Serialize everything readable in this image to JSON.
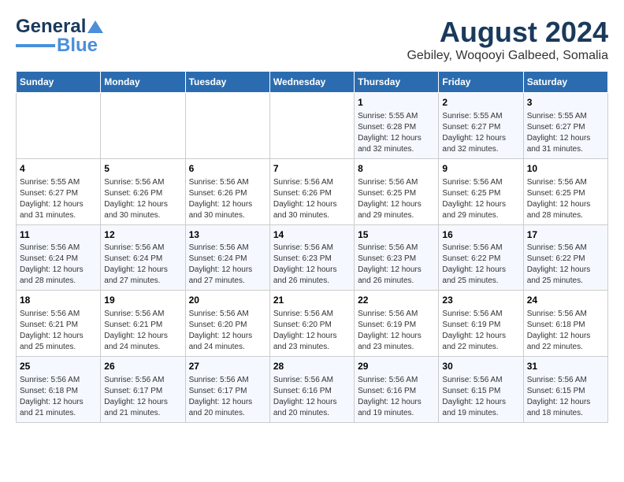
{
  "header": {
    "logo_line1": "General",
    "logo_line2": "Blue",
    "title": "August 2024",
    "subtitle": "Gebiley, Woqooyi Galbeed, Somalia"
  },
  "calendar": {
    "weekdays": [
      "Sunday",
      "Monday",
      "Tuesday",
      "Wednesday",
      "Thursday",
      "Friday",
      "Saturday"
    ],
    "weeks": [
      [
        {
          "day": "",
          "info": ""
        },
        {
          "day": "",
          "info": ""
        },
        {
          "day": "",
          "info": ""
        },
        {
          "day": "",
          "info": ""
        },
        {
          "day": "1",
          "info": "Sunrise: 5:55 AM\nSunset: 6:28 PM\nDaylight: 12 hours\nand 32 minutes."
        },
        {
          "day": "2",
          "info": "Sunrise: 5:55 AM\nSunset: 6:27 PM\nDaylight: 12 hours\nand 32 minutes."
        },
        {
          "day": "3",
          "info": "Sunrise: 5:55 AM\nSunset: 6:27 PM\nDaylight: 12 hours\nand 31 minutes."
        }
      ],
      [
        {
          "day": "4",
          "info": "Sunrise: 5:55 AM\nSunset: 6:27 PM\nDaylight: 12 hours\nand 31 minutes."
        },
        {
          "day": "5",
          "info": "Sunrise: 5:56 AM\nSunset: 6:26 PM\nDaylight: 12 hours\nand 30 minutes."
        },
        {
          "day": "6",
          "info": "Sunrise: 5:56 AM\nSunset: 6:26 PM\nDaylight: 12 hours\nand 30 minutes."
        },
        {
          "day": "7",
          "info": "Sunrise: 5:56 AM\nSunset: 6:26 PM\nDaylight: 12 hours\nand 30 minutes."
        },
        {
          "day": "8",
          "info": "Sunrise: 5:56 AM\nSunset: 6:25 PM\nDaylight: 12 hours\nand 29 minutes."
        },
        {
          "day": "9",
          "info": "Sunrise: 5:56 AM\nSunset: 6:25 PM\nDaylight: 12 hours\nand 29 minutes."
        },
        {
          "day": "10",
          "info": "Sunrise: 5:56 AM\nSunset: 6:25 PM\nDaylight: 12 hours\nand 28 minutes."
        }
      ],
      [
        {
          "day": "11",
          "info": "Sunrise: 5:56 AM\nSunset: 6:24 PM\nDaylight: 12 hours\nand 28 minutes."
        },
        {
          "day": "12",
          "info": "Sunrise: 5:56 AM\nSunset: 6:24 PM\nDaylight: 12 hours\nand 27 minutes."
        },
        {
          "day": "13",
          "info": "Sunrise: 5:56 AM\nSunset: 6:24 PM\nDaylight: 12 hours\nand 27 minutes."
        },
        {
          "day": "14",
          "info": "Sunrise: 5:56 AM\nSunset: 6:23 PM\nDaylight: 12 hours\nand 26 minutes."
        },
        {
          "day": "15",
          "info": "Sunrise: 5:56 AM\nSunset: 6:23 PM\nDaylight: 12 hours\nand 26 minutes."
        },
        {
          "day": "16",
          "info": "Sunrise: 5:56 AM\nSunset: 6:22 PM\nDaylight: 12 hours\nand 25 minutes."
        },
        {
          "day": "17",
          "info": "Sunrise: 5:56 AM\nSunset: 6:22 PM\nDaylight: 12 hours\nand 25 minutes."
        }
      ],
      [
        {
          "day": "18",
          "info": "Sunrise: 5:56 AM\nSunset: 6:21 PM\nDaylight: 12 hours\nand 25 minutes."
        },
        {
          "day": "19",
          "info": "Sunrise: 5:56 AM\nSunset: 6:21 PM\nDaylight: 12 hours\nand 24 minutes."
        },
        {
          "day": "20",
          "info": "Sunrise: 5:56 AM\nSunset: 6:20 PM\nDaylight: 12 hours\nand 24 minutes."
        },
        {
          "day": "21",
          "info": "Sunrise: 5:56 AM\nSunset: 6:20 PM\nDaylight: 12 hours\nand 23 minutes."
        },
        {
          "day": "22",
          "info": "Sunrise: 5:56 AM\nSunset: 6:19 PM\nDaylight: 12 hours\nand 23 minutes."
        },
        {
          "day": "23",
          "info": "Sunrise: 5:56 AM\nSunset: 6:19 PM\nDaylight: 12 hours\nand 22 minutes."
        },
        {
          "day": "24",
          "info": "Sunrise: 5:56 AM\nSunset: 6:18 PM\nDaylight: 12 hours\nand 22 minutes."
        }
      ],
      [
        {
          "day": "25",
          "info": "Sunrise: 5:56 AM\nSunset: 6:18 PM\nDaylight: 12 hours\nand 21 minutes."
        },
        {
          "day": "26",
          "info": "Sunrise: 5:56 AM\nSunset: 6:17 PM\nDaylight: 12 hours\nand 21 minutes."
        },
        {
          "day": "27",
          "info": "Sunrise: 5:56 AM\nSunset: 6:17 PM\nDaylight: 12 hours\nand 20 minutes."
        },
        {
          "day": "28",
          "info": "Sunrise: 5:56 AM\nSunset: 6:16 PM\nDaylight: 12 hours\nand 20 minutes."
        },
        {
          "day": "29",
          "info": "Sunrise: 5:56 AM\nSunset: 6:16 PM\nDaylight: 12 hours\nand 19 minutes."
        },
        {
          "day": "30",
          "info": "Sunrise: 5:56 AM\nSunset: 6:15 PM\nDaylight: 12 hours\nand 19 minutes."
        },
        {
          "day": "31",
          "info": "Sunrise: 5:56 AM\nSunset: 6:15 PM\nDaylight: 12 hours\nand 18 minutes."
        }
      ]
    ]
  }
}
